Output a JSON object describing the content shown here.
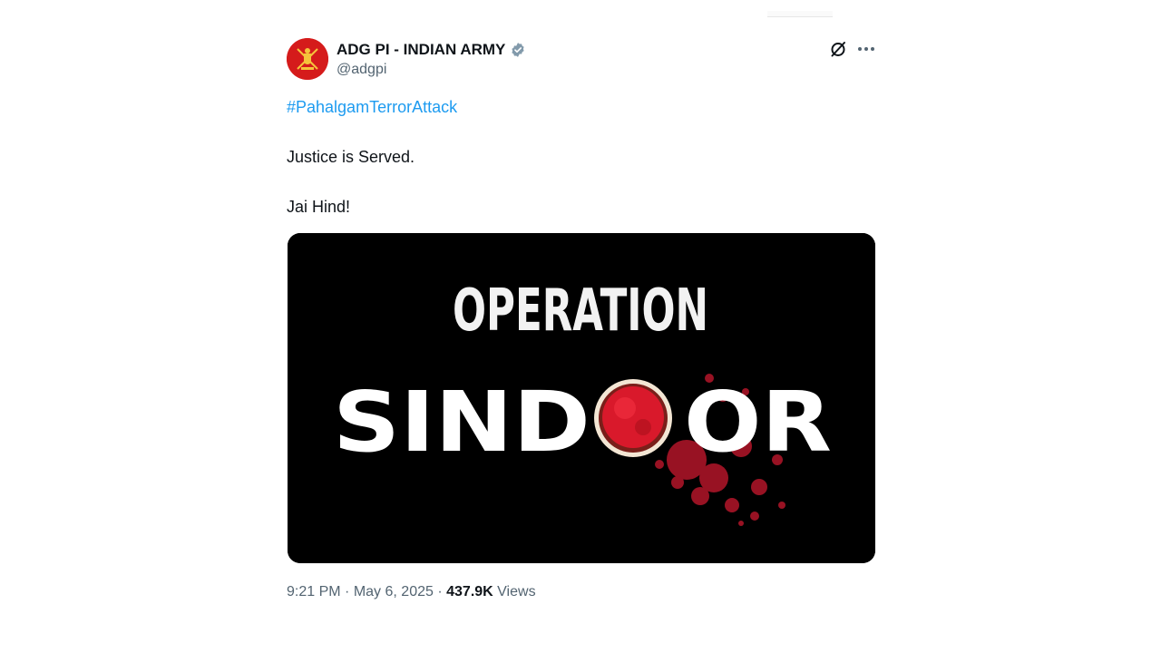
{
  "tweet": {
    "author_name": "ADG PI - INDIAN ARMY",
    "handle": "@adgpi",
    "verified": true,
    "hashtag": "#PahalgamTerrorAttack",
    "lines": [
      "Justice is Served.",
      "Jai Hind!"
    ],
    "time": "9:21 PM",
    "separator": "·",
    "date": "May 6, 2025",
    "views_count": "437.9K",
    "views_label": "Views"
  },
  "media": {
    "headline_top": "OPERATION",
    "headline_left": "SIND",
    "headline_right": "OR"
  },
  "icons": {
    "verified": "verified-badge-icon",
    "grok": "grok-icon",
    "more": "more-options-icon"
  },
  "colors": {
    "link": "#1d9bf0",
    "secondary_text": "#536471",
    "sindoor_red": "#d9192b",
    "avatar_red": "#d51b1b"
  }
}
